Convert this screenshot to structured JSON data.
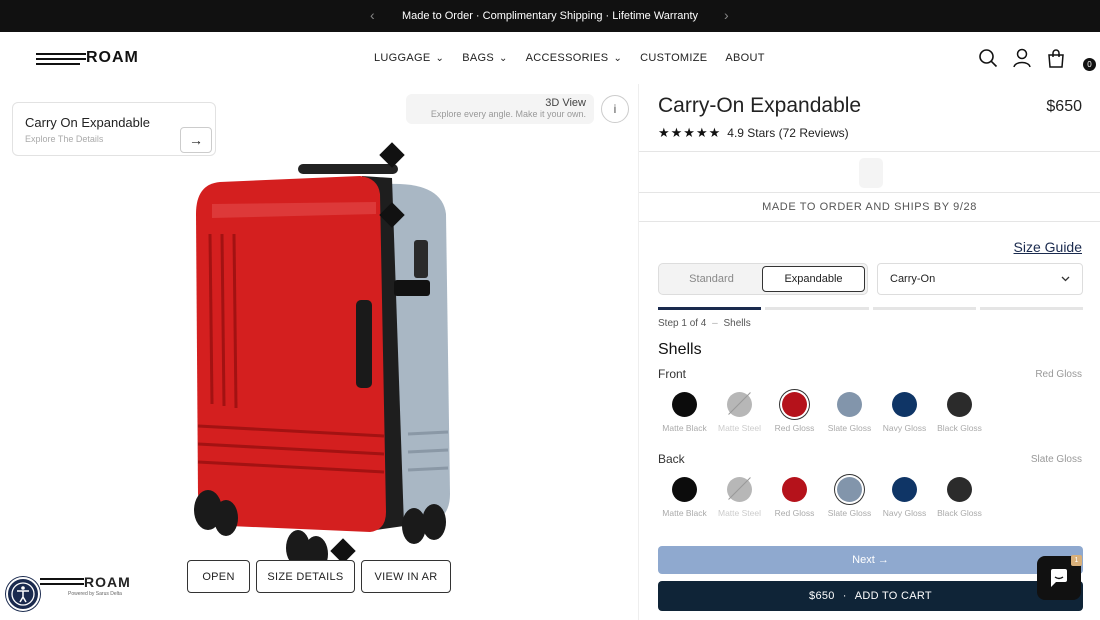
{
  "announcement": {
    "text": "Made to Order · Complimentary Shipping · Lifetime Warranty",
    "prev": "‹",
    "next": "›"
  },
  "header": {
    "logo": "ROAM",
    "nav": [
      "LUGGAGE",
      "BAGS",
      "ACCESSORIES",
      "CUSTOMIZE",
      "ABOUT"
    ],
    "nav_dropdown_chevron": "⌄",
    "icons": [
      "search-icon",
      "account-icon",
      "cart-icon"
    ],
    "cart_count": "0"
  },
  "stage": {
    "card_title": "Carry On Expandable",
    "card_subtitle": "Explore The Details",
    "card_arrow": "→",
    "view3d_title": "3D View",
    "view3d_subtitle": "Explore every angle. Make it your own.",
    "info_glyph": "i",
    "buttons": [
      "OPEN",
      "SIZE DETAILS",
      "VIEW IN AR"
    ],
    "watermark": "ROAM",
    "powered_by": "Powered by",
    "powered_brand": "Sarus Delta",
    "colors": {
      "front": "#d41f1f",
      "back": "#a9b7c4",
      "handle": "#222222"
    }
  },
  "product": {
    "title": "Carry-On Expandable",
    "price": "$650",
    "stars": "★★★★★",
    "rating_text": "4.9 Stars (72 Reviews)",
    "ship_notice": "MADE TO ORDER AND SHIPS BY 9/28",
    "size_guide": "Size Guide",
    "variants": [
      "Standard",
      "Expandable"
    ],
    "active_variant": "Expandable",
    "size_select": "Carry-On",
    "progress_steps": 4,
    "current_step": 1,
    "step_label": "Step 1 of 4",
    "step_separator": "–",
    "step_name": "Shells",
    "section_title": "Shells",
    "front": {
      "label": "Front",
      "selected": "Red Gloss",
      "swatches": [
        {
          "name": "Matte Black",
          "color": "#0c0c0c"
        },
        {
          "name": "Matte Steel",
          "color": "#b7b7b7",
          "disabled": true
        },
        {
          "name": "Red Gloss",
          "color": "#b5121b",
          "selected": true
        },
        {
          "name": "Slate Gloss",
          "color": "#8295ab"
        },
        {
          "name": "Navy Gloss",
          "color": "#0f3566"
        },
        {
          "name": "Black Gloss",
          "color": "#2b2b2b"
        }
      ]
    },
    "back": {
      "label": "Back",
      "selected": "Slate Gloss",
      "swatches": [
        {
          "name": "Matte Black",
          "color": "#0c0c0c"
        },
        {
          "name": "Matte Steel",
          "color": "#b7b7b7",
          "disabled": true
        },
        {
          "name": "Red Gloss",
          "color": "#b5121b"
        },
        {
          "name": "Slate Gloss",
          "color": "#8295ab",
          "selected": true
        },
        {
          "name": "Navy Gloss",
          "color": "#0f3566"
        },
        {
          "name": "Black Gloss",
          "color": "#2b2b2b"
        }
      ]
    },
    "next_label": "Next →",
    "cart_price": "$650",
    "cart_separator": "·",
    "cart_label": "ADD TO CART"
  },
  "chat": {
    "badge": "1"
  }
}
